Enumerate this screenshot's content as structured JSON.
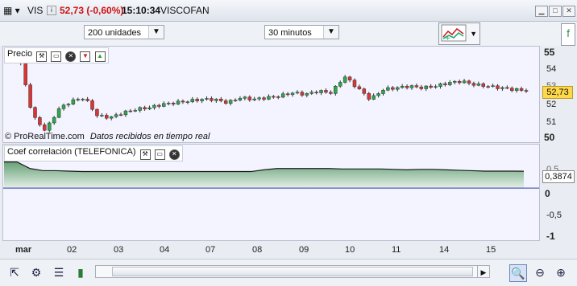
{
  "titlebar": {
    "symbol": "VIS",
    "price_change": "52,73 (-0,60%)",
    "time": "15:10:34",
    "instrument": "VISCOFAN",
    "price_change_color": "#cc1111"
  },
  "toolbar": {
    "units_select": "200 unidades",
    "period_select": "30 minutos"
  },
  "price_panel": {
    "title": "Precio",
    "watermark": "© ProRealTime.com",
    "status_note": "Datos recibidos en tiempo real",
    "current_price": "52,73",
    "price_label_color": "#ffd84a",
    "y_ticks": [
      "55",
      "54",
      "53",
      "52",
      "51",
      "50"
    ]
  },
  "indicator_panel": {
    "title": "Coef correlación (TELEFONICA)",
    "current_value": "0,3874",
    "y_ticks": [
      "0,5",
      "0",
      "-0,5",
      "-1"
    ],
    "fill_color": "#5f9d6f"
  },
  "x_axis": {
    "labels": [
      "mar",
      "02",
      "03",
      "04",
      "07",
      "08",
      "09",
      "10",
      "11",
      "14",
      "15"
    ]
  },
  "chart_data": {
    "type": "candlestick",
    "price_series_approx": [
      55.1,
      54.7,
      51.2,
      50.3,
      51.6,
      52.1,
      52.3,
      51.2,
      51.1,
      51.4,
      51.6,
      51.7,
      51.9,
      52.0,
      52.1,
      52.2,
      52.2,
      52.0,
      52.3,
      52.2,
      52.3,
      52.4,
      52.6,
      52.5,
      52.7,
      52.6,
      53.6,
      52.9,
      52.2,
      52.8,
      52.9,
      53.0,
      52.9,
      53.0,
      53.2,
      53.3,
      53.1,
      53.0,
      52.9,
      52.8,
      52.73
    ],
    "correlation_series_approx": [
      0.6,
      0.6,
      0.45,
      0.4,
      0.4,
      0.39,
      0.38,
      0.38,
      0.38,
      0.38,
      0.38,
      0.38,
      0.38,
      0.38,
      0.38,
      0.38,
      0.38,
      0.38,
      0.38,
      0.38,
      0.42,
      0.45,
      0.45,
      0.45,
      0.45,
      0.45,
      0.44,
      0.44,
      0.44,
      0.44,
      0.43,
      0.42,
      0.43,
      0.43,
      0.42,
      0.41,
      0.4,
      0.39,
      0.39,
      0.39,
      0.3874
    ],
    "ylim_price": [
      49.6,
      55.4
    ],
    "ylim_correlation": [
      -1.2,
      1.0
    ]
  }
}
